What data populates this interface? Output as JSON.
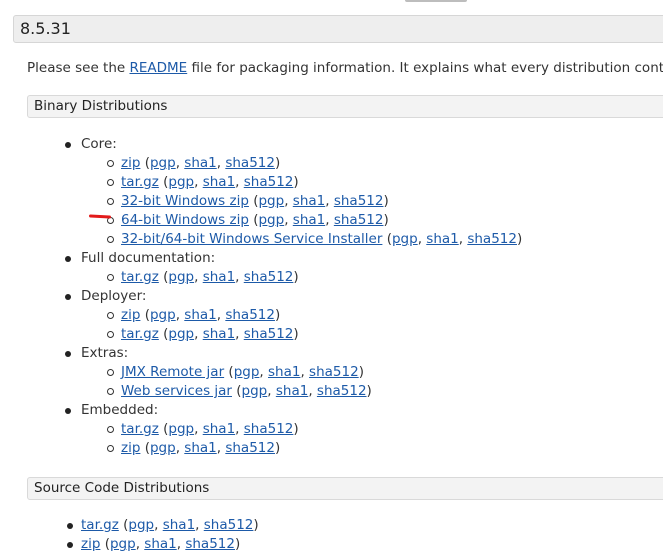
{
  "version": "8.5.31",
  "intro": {
    "before": "Please see the ",
    "link": "README",
    "after": " file for packaging information. It explains what every distribution contains"
  },
  "binary": {
    "title": "Binary Distributions",
    "groups": [
      {
        "label": "Core:",
        "items": [
          "zip",
          "tar.gz",
          "32-bit Windows zip",
          "64-bit Windows zip",
          "32-bit/64-bit Windows Service Installer"
        ]
      },
      {
        "label": "Full documentation:",
        "items": [
          "tar.gz"
        ]
      },
      {
        "label": "Deployer:",
        "items": [
          "zip",
          "tar.gz"
        ]
      },
      {
        "label": "Extras:",
        "items": [
          "JMX Remote jar",
          "Web services jar"
        ]
      },
      {
        "label": "Embedded:",
        "items": [
          "tar.gz",
          "zip"
        ]
      }
    ]
  },
  "source": {
    "title": "Source Code Distributions",
    "items": [
      "tar.gz",
      "zip"
    ]
  },
  "sig": {
    "pgp": "pgp",
    "sha1": "sha1",
    "sha512": "sha512"
  },
  "colors": {
    "link": "#1d5aa8",
    "annotation": "#e31b1b"
  }
}
